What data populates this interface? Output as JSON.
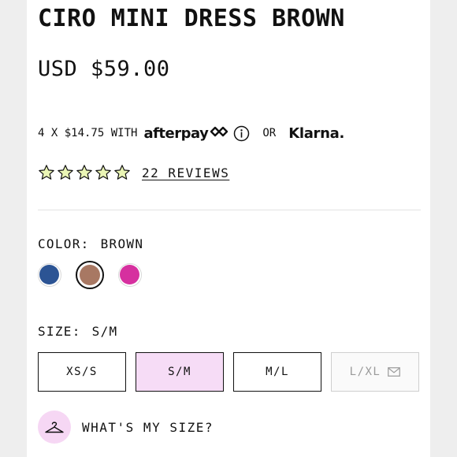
{
  "product": {
    "title": "CIRO MINI DRESS BROWN",
    "price": "USD $59.00"
  },
  "payment": {
    "installments_text": "4 X $14.75 WITH",
    "afterpay_logo": "afterpay",
    "afterpay_icon": "afterpay-arrows-icon",
    "info_icon": "info-icon",
    "or_text": "OR",
    "klarna_logo": "Klarna."
  },
  "rating": {
    "stars": 5,
    "filled_stars": 5,
    "star_color": "#eaf5b5",
    "reviews_label": "22 REVIEWS"
  },
  "color": {
    "label": "COLOR:",
    "selected": "BROWN",
    "swatches": [
      {
        "name": "blue",
        "hex": "#2c5494",
        "selected": false
      },
      {
        "name": "brown",
        "hex": "#a87863",
        "selected": true
      },
      {
        "name": "magenta",
        "hex": "#d6309f",
        "selected": false
      }
    ]
  },
  "size": {
    "label": "SIZE:",
    "selected": "S/M",
    "options": [
      {
        "label": "XS/S",
        "state": "available"
      },
      {
        "label": "S/M",
        "state": "selected"
      },
      {
        "label": "M/L",
        "state": "available"
      },
      {
        "label": "L/XL",
        "state": "sold-out",
        "icon": "mail-icon"
      }
    ],
    "selected_bg": "#f6dcf6"
  },
  "size_help": {
    "icon": "hanger-icon",
    "label": "WHAT'S MY SIZE?",
    "icon_bg": "#f6d7f4"
  }
}
